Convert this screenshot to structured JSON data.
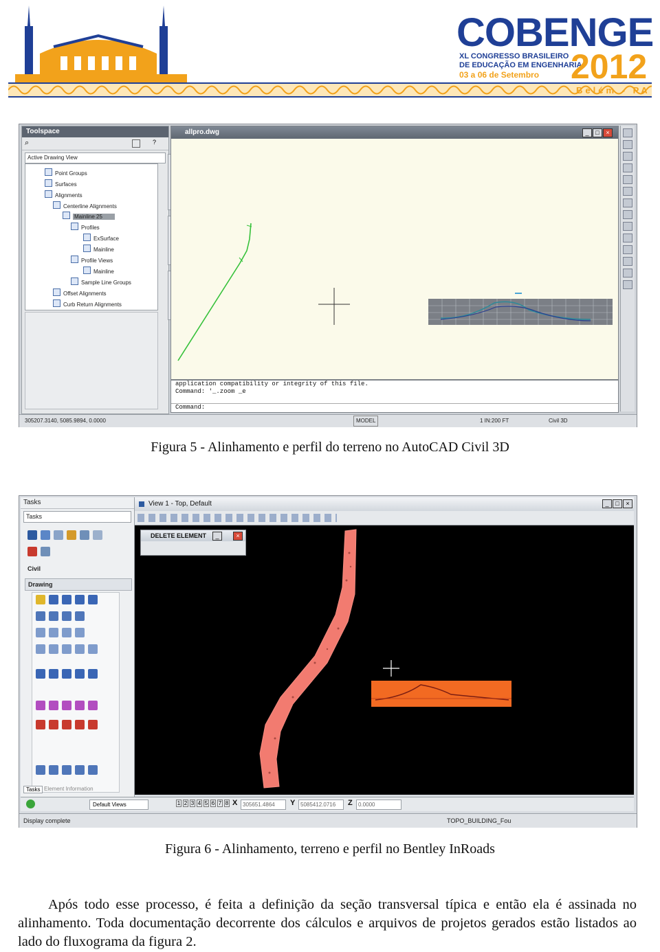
{
  "header": {
    "conference_name": "COBENGE",
    "conference_line1": "XL CONGRESSO BRASILEIRO",
    "conference_line2": "DE EDUCAÇÃO EM ENGENHARIA",
    "dates": "03 a 06 de Setembro",
    "year": "2012",
    "location": "Belém - PA"
  },
  "figure5": {
    "caption": "Figura 5 - Alinhamento e perfil do terreno no AutoCAD Civil 3D",
    "toolspace": {
      "title": "Toolspace",
      "view_select": "Active Drawing View",
      "tree": [
        "Point Groups",
        "Surfaces",
        "Alignments",
        "Centerline Alignments",
        "Mainline 25",
        "Profiles",
        "ExSurface",
        "Mainline",
        "Profile Views",
        "Mainline",
        "Sample Line Groups",
        "Offset Alignments",
        "Curb Return Alignments"
      ],
      "side_tabs": [
        "Prospector",
        "Settings",
        "Survey"
      ]
    },
    "drawing": {
      "title": "allpro.dwg",
      "command_lines": [
        "application compatibility or integrity of this file.",
        "Command: '_.zoom _e",
        "",
        "Command:"
      ]
    },
    "statusbar": {
      "coords": "305207.3140, 5085.9894, 0.0000",
      "model": "MODEL",
      "scale": "1 IN:200 FT",
      "workspace": "Civil 3D"
    }
  },
  "figure6": {
    "caption": "Figura 6 - Alinhamento, terreno e perfil no Bentley InRoads",
    "tasks": {
      "title": "Tasks",
      "combo": "Tasks",
      "civil": "Civil",
      "drawing_section": "Drawing",
      "bottom_tabs": [
        "Tasks",
        "Element Information"
      ]
    },
    "view_title": "View 1 - Top, Default",
    "dialog_title": "DELETE ELEMENT",
    "view_select": "Default Views",
    "view_numbers": [
      "1",
      "2",
      "3",
      "4",
      "5",
      "6",
      "7",
      "8"
    ],
    "coords": {
      "x_label": "X",
      "x": "305651.4864",
      "y_label": "Y",
      "y": "5085412.0716",
      "z_label": "Z",
      "z": "0.0000"
    },
    "statusbar": {
      "left": "Display complete",
      "level": "TOPO_BUILDING_Fou"
    }
  },
  "paragraph": "Após todo esse processo, é feita a definição da seção transversal típica e então ela é assinada no alinhamento. Toda documentação decorrente dos cálculos e arquivos de projetos gerados estão listados ao lado do fluxograma da figura 2."
}
